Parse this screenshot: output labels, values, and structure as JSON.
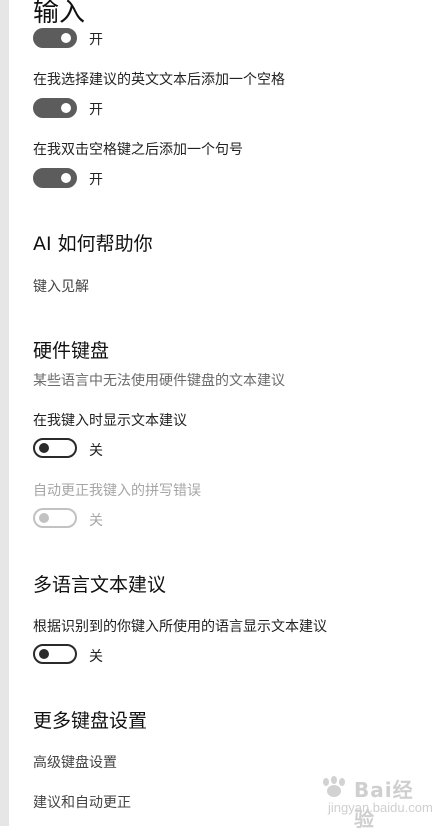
{
  "page": {
    "title": "输入"
  },
  "typing": {
    "toggle_top": {
      "state": "开",
      "on": true
    },
    "add_space": {
      "label": "在我选择建议的英文文本后添加一个空格",
      "state": "开",
      "on": true
    },
    "add_period": {
      "label": "在我双击空格键之后添加一个句号",
      "state": "开",
      "on": true
    }
  },
  "ai": {
    "heading": "AI 如何帮助你",
    "link": "键入见解"
  },
  "hardware": {
    "heading": "硬件键盘",
    "description": "某些语言中无法使用硬件键盘的文本建议",
    "show_suggestions": {
      "label": "在我键入时显示文本建议",
      "state": "关",
      "on": false
    },
    "autocorrect": {
      "label": "自动更正我键入的拼写错误",
      "state": "关",
      "on": false,
      "disabled": true
    }
  },
  "multilingual": {
    "heading": "多语言文本建议",
    "suggestions": {
      "label": "根据识别到的你键入所使用的语言显示文本建议",
      "state": "关",
      "on": false
    }
  },
  "more": {
    "heading": "更多键盘设置",
    "advanced_link": "高级键盘设置",
    "autocorrect_link": "建议和自动更正"
  },
  "colors": {
    "toggle_on": "#5c5c5c",
    "toggle_off_border": "#2a2a2a",
    "disabled": "#c2c2c2"
  }
}
